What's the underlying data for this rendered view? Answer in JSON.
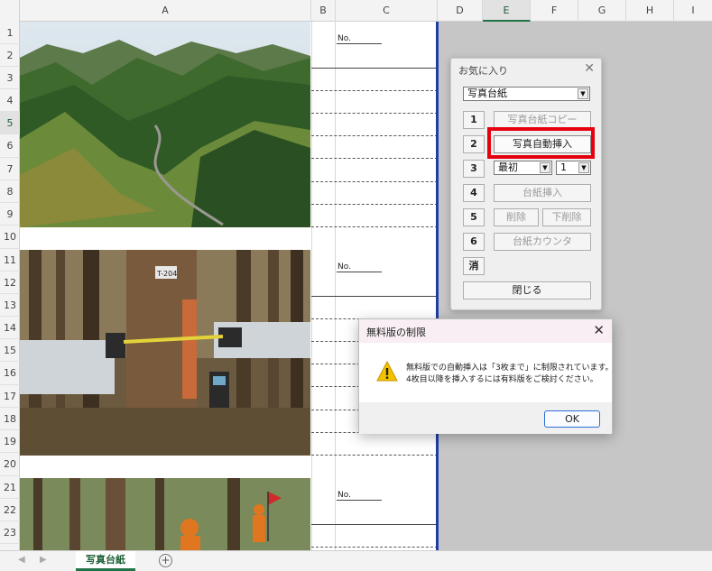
{
  "columns": {
    "a": "A",
    "b": "B",
    "c": "C",
    "d": "D",
    "e": "E",
    "f": "F",
    "g": "G",
    "h": "H",
    "i": "I"
  },
  "rows": [
    "1",
    "2",
    "3",
    "4",
    "5",
    "6",
    "7",
    "8",
    "9",
    "10",
    "11",
    "12",
    "13",
    "14",
    "15",
    "16",
    "17",
    "18",
    "19",
    "20",
    "21",
    "22",
    "23"
  ],
  "sheet": {
    "no_label_1": "No.",
    "no_label_2": "No.",
    "no_label_3": "No."
  },
  "favorites": {
    "title": "お気に入り",
    "close": "✕",
    "dropdown_value": "写真台紙",
    "rows": [
      {
        "num": "1",
        "label": "写真台紙コピー"
      },
      {
        "num": "2",
        "label": "写真自動挿入"
      },
      {
        "num": "3",
        "sel1": "最初",
        "sel2": "1"
      },
      {
        "num": "4",
        "label": "台紙挿入"
      },
      {
        "num": "5",
        "label_a": "削除",
        "label_b": "下削除"
      },
      {
        "num": "6",
        "label": "台紙カウンタ"
      },
      {
        "num": "消"
      }
    ],
    "close_button": "閉じる"
  },
  "dialog": {
    "title": "無料版の制限",
    "close": "✕",
    "line1": "無料版での自動挿入は「3枚まで」に制限されています。",
    "line2": "4枚目以降を挿入するには有料版をご検討ください。",
    "ok": "OK"
  },
  "tabbar": {
    "nav_left": "◀",
    "nav_right": "▶",
    "active_tab": "写真台紙",
    "add": "+"
  },
  "colors": {
    "selection_frame": "#e6000f",
    "sheet_border": "#1f3fa8",
    "excel_green": "#217346"
  }
}
